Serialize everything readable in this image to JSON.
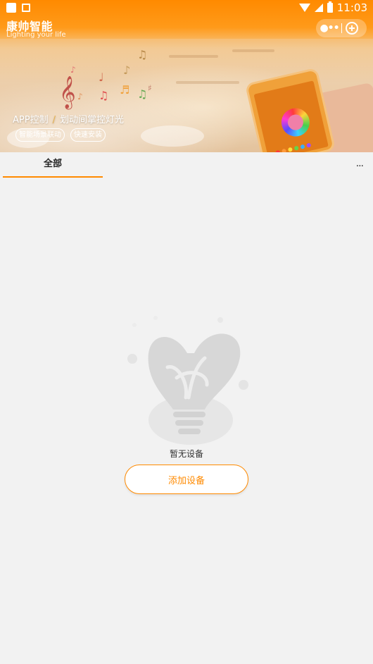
{
  "status_bar": {
    "time": "11:03"
  },
  "header": {
    "title": "康帅智能",
    "subtitle": "Lighting your life",
    "menu_icon": "more-dots-icon",
    "add_icon": "add-circle-icon"
  },
  "banner": {
    "promo_left": "APP控制",
    "promo_separator": "/",
    "promo_right": "划动间掌控灯光",
    "tag_1": "智能场景联动",
    "tag_2": "快速安装"
  },
  "tabs": {
    "active": "全部",
    "more": "..."
  },
  "empty_state": {
    "message": "暂无设备",
    "button": "添加设备"
  },
  "colors": {
    "accent": "#ff8a00",
    "background": "#f2f2f2"
  }
}
